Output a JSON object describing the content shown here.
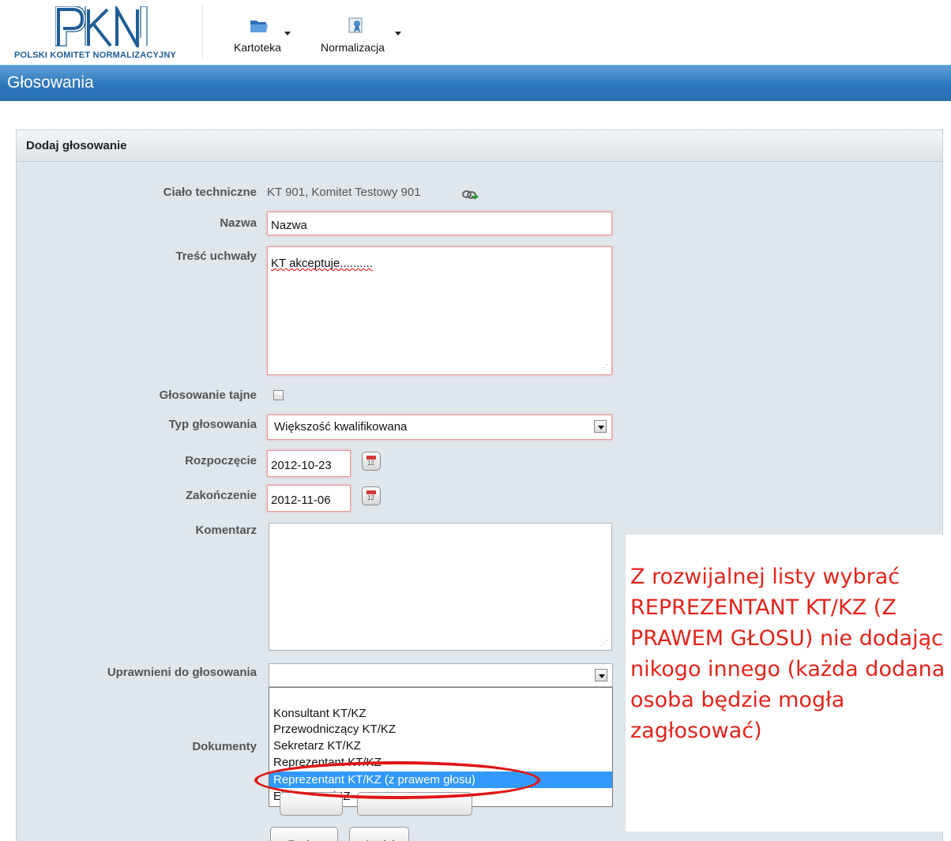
{
  "header": {
    "logo_text": "POLSKI KOMITET NORMALIZACYJNY",
    "menu": [
      {
        "label": "Kartoteka",
        "icon": "folder-icon"
      },
      {
        "label": "Normalizacja",
        "icon": "certificate-icon"
      }
    ]
  },
  "page_title": "Głosowania",
  "panel": {
    "title": "Dodaj głosowanie",
    "technical_body": {
      "label": "Ciało techniczne",
      "value": "KT 901, Komitet Testowy 901"
    },
    "name": {
      "label": "Nazwa",
      "value": "Nazwa"
    },
    "resolution": {
      "label": "Treść uchwały",
      "value": "KT akceptuje.........."
    },
    "secret_vote": {
      "label": "Głosowanie tajne",
      "checked": false
    },
    "vote_type": {
      "label": "Typ głosowania",
      "value": "Większość kwalifikowana"
    },
    "start": {
      "label": "Rozpoczęcie",
      "value": "2012-10-23"
    },
    "end": {
      "label": "Zakończenie",
      "value": "2012-11-06"
    },
    "comment": {
      "label": "Komentarz",
      "value": ""
    },
    "eligible": {
      "label": "Uprawnieni do głosowania",
      "value": "",
      "options": [
        "Konsultant KT/KZ",
        "Przewodniczący KT/KZ",
        "Sekretarz KT/KZ",
        "Reprezentant KT/KZ",
        "Reprezentant KT/KZ (z prawem głosu)",
        "Ekspert KT/KZ"
      ],
      "highlighted_option": "Reprezentant KT/KZ (z prawem głosu)"
    },
    "documents": {
      "label": "Dokumenty"
    },
    "buttons": {
      "save": "Zapisz",
      "cancel": "Anuluj"
    }
  },
  "annotation": {
    "text": "Z rozwijalnej listy wybrać REPREZENTANT KT/KZ (Z PRAWEM GŁOSU) nie dodając nikogo innego (każda dodana osoba będzie mogła zagłosować)",
    "color": "#e3241b"
  },
  "colors": {
    "title_bar": "#2e77bd",
    "panel_bg": "#dfe6ec",
    "selection": "#3399ff",
    "required_border": "#e49a9a"
  }
}
